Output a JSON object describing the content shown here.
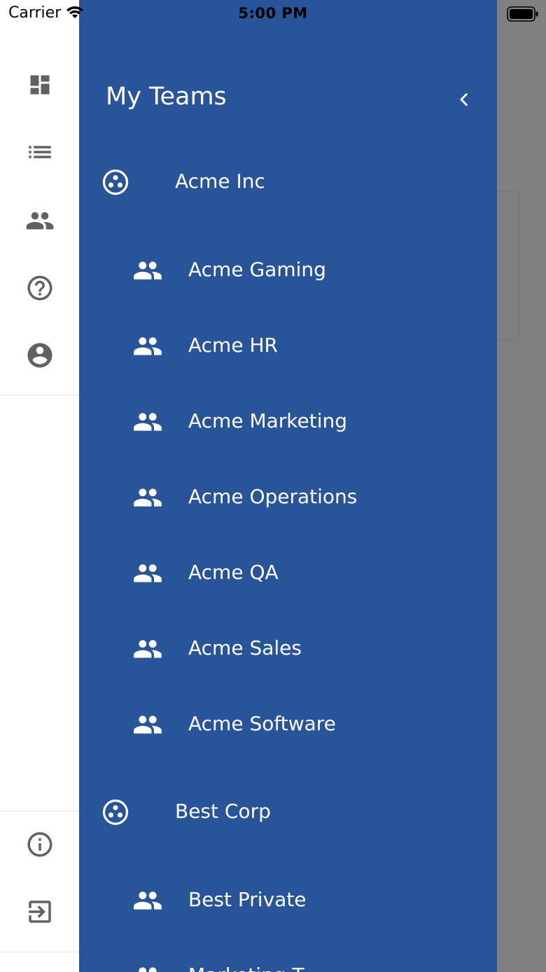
{
  "status_bar": {
    "carrier": "Carrier",
    "time": "5:00 PM"
  },
  "left_rail": {
    "top_icons": [
      "dashboard-icon",
      "list-icon",
      "people-icon",
      "help-icon",
      "account-icon"
    ],
    "bottom_icons": [
      "info-icon",
      "logout-icon"
    ]
  },
  "drawer": {
    "title": "My Teams",
    "background": "#285499",
    "orgs": [
      {
        "name": "Acme Inc",
        "teams": [
          "Acme Gaming",
          "Acme HR",
          "Acme Marketing",
          "Acme Operations",
          "Acme QA",
          "Acme Sales",
          "Acme Software"
        ]
      },
      {
        "name": "Best Corp",
        "teams": [
          "Best Private",
          "Marketing T"
        ]
      }
    ]
  },
  "overlay_color": "#808080"
}
